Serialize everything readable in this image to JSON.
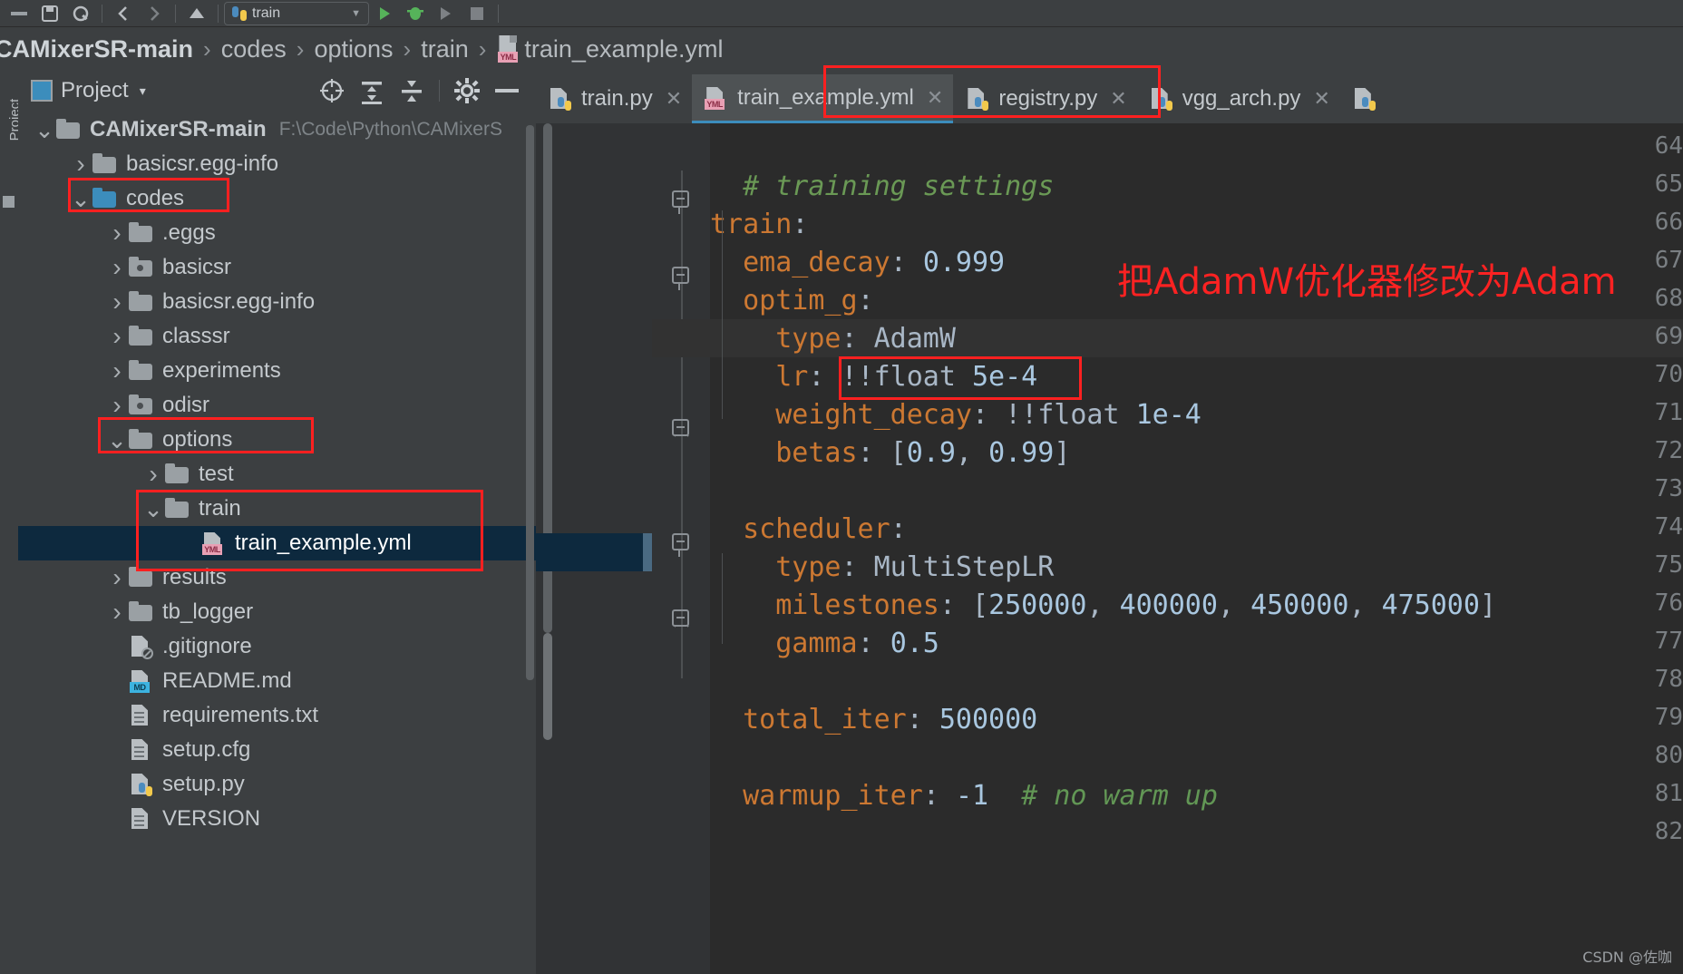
{
  "toolbar": {
    "icons": [
      "save-icon",
      "sync-icon",
      "back-icon",
      "forward-icon",
      "build-icon"
    ],
    "run_config_label": "train",
    "run_icon": "run-icon",
    "debug_icon": "debug-icon",
    "coverage_icon": "coverage-icon",
    "stop_icon": "stop-icon"
  },
  "breadcrumb": {
    "items": [
      "CAMixerSR-main",
      "codes",
      "options",
      "train"
    ],
    "file": "train_example.yml",
    "file_icon": "yml-file-icon",
    "separator": "›"
  },
  "sidebar_strip": {
    "vertical_tab_label": "Project"
  },
  "project_panel": {
    "title": "Project",
    "caret": "▾",
    "module_icon": "module-icon",
    "toolbar_icons": [
      "select-opened-file-icon",
      "expand-all-icon",
      "collapse-all-icon",
      "settings-gear-icon",
      "hide-panel-icon"
    ],
    "tree": [
      {
        "label": "CAMixerSR-main",
        "path": "F:\\Code\\Python\\CAMixerS",
        "indent": 0,
        "arrow": "down",
        "icon": "folder",
        "bold": true
      },
      {
        "label": "basicsr.egg-info",
        "indent": 1,
        "arrow": "right",
        "icon": "folder"
      },
      {
        "label": "codes",
        "indent": 1,
        "arrow": "down",
        "icon": "folder-blue",
        "highlight": true
      },
      {
        "label": ".eggs",
        "indent": 2,
        "arrow": "right",
        "icon": "folder"
      },
      {
        "label": "basicsr",
        "indent": 2,
        "arrow": "right",
        "icon": "folder-source"
      },
      {
        "label": "basicsr.egg-info",
        "indent": 2,
        "arrow": "right",
        "icon": "folder"
      },
      {
        "label": "classsr",
        "indent": 2,
        "arrow": "right",
        "icon": "folder"
      },
      {
        "label": "experiments",
        "indent": 2,
        "arrow": "right",
        "icon": "folder"
      },
      {
        "label": "odisr",
        "indent": 2,
        "arrow": "right",
        "icon": "folder-source"
      },
      {
        "label": "options",
        "indent": 2,
        "arrow": "down",
        "icon": "folder",
        "highlight": true
      },
      {
        "label": "test",
        "indent": 3,
        "arrow": "right",
        "icon": "folder"
      },
      {
        "label": "train",
        "indent": 3,
        "arrow": "down",
        "icon": "folder",
        "highlight": true
      },
      {
        "label": "train_example.yml",
        "indent": 4,
        "arrow": "none",
        "icon": "yml-file",
        "selected": true,
        "highlight": true
      },
      {
        "label": "results",
        "indent": 2,
        "arrow": "right",
        "icon": "folder"
      },
      {
        "label": "tb_logger",
        "indent": 2,
        "arrow": "right",
        "icon": "folder"
      },
      {
        "label": ".gitignore",
        "indent": 2,
        "arrow": "none",
        "icon": "gitignore-file"
      },
      {
        "label": "README.md",
        "indent": 2,
        "arrow": "none",
        "icon": "md-file"
      },
      {
        "label": "requirements.txt",
        "indent": 2,
        "arrow": "none",
        "icon": "txt-file"
      },
      {
        "label": "setup.cfg",
        "indent": 2,
        "arrow": "none",
        "icon": "txt-file"
      },
      {
        "label": "setup.py",
        "indent": 2,
        "arrow": "none",
        "icon": "py-file"
      },
      {
        "label": "VERSION",
        "indent": 2,
        "arrow": "none",
        "icon": "txt-file"
      }
    ]
  },
  "editor": {
    "tabs": [
      {
        "label": "train.py",
        "icon": "py-file",
        "active": false
      },
      {
        "label": "train_example.yml",
        "icon": "yml-file",
        "active": true,
        "highlight": true
      },
      {
        "label": "registry.py",
        "icon": "py-file",
        "active": false
      },
      {
        "label": "vgg_arch.py",
        "icon": "py-file",
        "active": false
      }
    ],
    "close_label": "✕",
    "lines": [
      {
        "num": "64",
        "text": ""
      },
      {
        "num": "65",
        "html": "<span class=\"c\">  # training settings</span>"
      },
      {
        "num": "66",
        "html": "<span class=\"k\">train</span><span class=\"s\">:</span>"
      },
      {
        "num": "67",
        "html": "<span class=\"k\">  ema_decay</span><span class=\"s\">: </span><span class=\"n\">0.999</span>"
      },
      {
        "num": "68",
        "html": "<span class=\"k\">  optim_g</span><span class=\"s\">:</span>"
      },
      {
        "num": "69",
        "html": "<span class=\"k\">    type</span><span class=\"s\">: AdamW</span>",
        "highlighted": true
      },
      {
        "num": "70",
        "html": "<span class=\"k\">    lr</span><span class=\"s\">: !!float </span><span class=\"n\">5e-4</span>"
      },
      {
        "num": "71",
        "html": "<span class=\"k\">    weight_decay</span><span class=\"s\">: !!float </span><span class=\"n\">1e-4</span>"
      },
      {
        "num": "72",
        "html": "<span class=\"k\">    betas</span><span class=\"s\">: [</span><span class=\"n\">0.9</span><span class=\"s\">, </span><span class=\"n\">0.99</span><span class=\"s\">]</span>"
      },
      {
        "num": "73",
        "text": ""
      },
      {
        "num": "74",
        "html": "<span class=\"k\">  scheduler</span><span class=\"s\">:</span>"
      },
      {
        "num": "75",
        "html": "<span class=\"k\">    type</span><span class=\"s\">: MultiStepLR</span>"
      },
      {
        "num": "76",
        "html": "<span class=\"k\">    milestones</span><span class=\"s\">: [</span><span class=\"n\">250000</span><span class=\"s\">, </span><span class=\"n\">400000</span><span class=\"s\">, </span><span class=\"n\">450000</span><span class=\"s\">, </span><span class=\"n\">475000</span><span class=\"s\">]</span>"
      },
      {
        "num": "77",
        "html": "<span class=\"k\">    gamma</span><span class=\"s\">: </span><span class=\"n\">0.5</span>"
      },
      {
        "num": "78",
        "text": ""
      },
      {
        "num": "79",
        "html": "<span class=\"k\">  total_iter</span><span class=\"s\">: </span><span class=\"n\">500000</span>"
      },
      {
        "num": "80",
        "text": ""
      },
      {
        "num": "81",
        "html": "<span class=\"k\">  warmup_iter</span><span class=\"s\">: </span><span class=\"n\">-1</span><span class=\"s\">  </span><span class=\"cm\"># no warm up</span>"
      },
      {
        "num": "82",
        "text": ""
      }
    ]
  },
  "annotations": {
    "note_text": "把AdamW优化器修改为Adam",
    "note_color": "#fb2222",
    "box_color": "#fe2020"
  },
  "watermark": "CSDN @佐咖"
}
